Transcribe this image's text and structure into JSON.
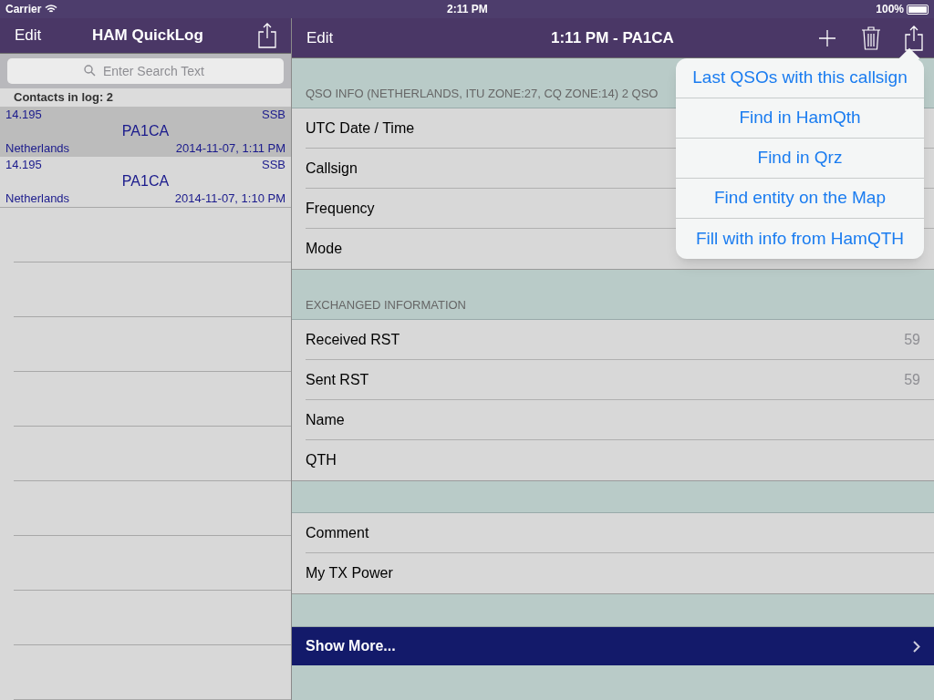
{
  "status_bar": {
    "carrier": "Carrier",
    "time": "2:11 PM",
    "battery": "100%"
  },
  "left_nav": {
    "edit": "Edit",
    "title": "HAM QuickLog"
  },
  "search": {
    "placeholder": "Enter Search Text"
  },
  "log_header": "Contacts in log: 2",
  "contacts": [
    {
      "frequency": "14.195",
      "mode": "SSB",
      "callsign": "PA1CA",
      "country": "Netherlands",
      "datetime": "2014-11-07, 1:11 PM",
      "selected": true
    },
    {
      "frequency": "14.195",
      "mode": "SSB",
      "callsign": "PA1CA",
      "country": "Netherlands",
      "datetime": "2014-11-07, 1:10 PM",
      "selected": false
    }
  ],
  "right_nav": {
    "edit": "Edit",
    "title": "1:11 PM - PA1CA"
  },
  "sections": [
    {
      "header": "QSO INFO (NETHERLANDS, ITU ZONE:27, CQ ZONE:14) 2 QSO",
      "rows": [
        {
          "label": "UTC Date / Time"
        },
        {
          "label": "Callsign"
        },
        {
          "label": "Frequency"
        },
        {
          "label": "Mode"
        }
      ]
    },
    {
      "header": "EXCHANGED INFORMATION",
      "rows": [
        {
          "label": "Received RST",
          "value": "59"
        },
        {
          "label": "Sent RST",
          "value": "59"
        },
        {
          "label": "Name"
        },
        {
          "label": "QTH"
        }
      ]
    },
    {
      "rows": [
        {
          "label": "Comment"
        },
        {
          "label": "My TX Power"
        }
      ]
    }
  ],
  "show_more": "Show More...",
  "popover": [
    "Last QSOs with this callsign",
    "Find in HamQth",
    "Find in Qrz",
    "Find entity on the Map",
    "Fill with info from HamQTH"
  ]
}
